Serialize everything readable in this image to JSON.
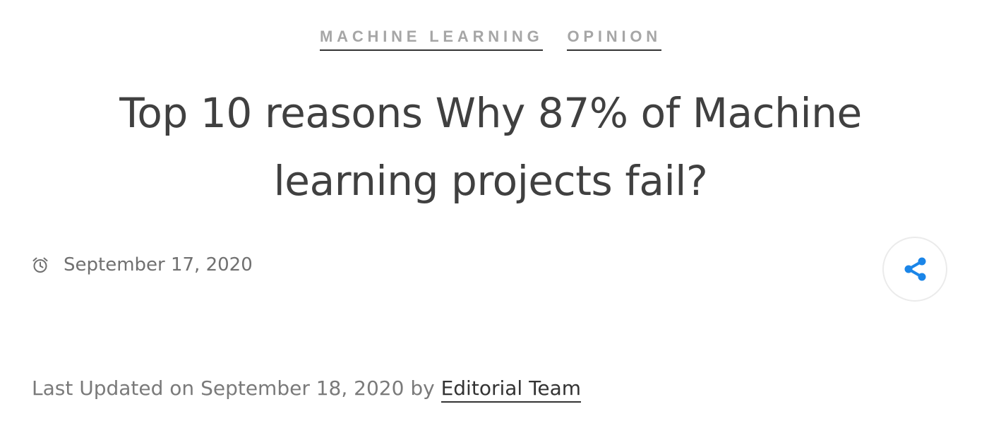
{
  "categories": [
    {
      "label": "MACHINE LEARNING"
    },
    {
      "label": "OPINION"
    }
  ],
  "article": {
    "title": "Top 10 reasons Why 87% of Machine learning projects fail?",
    "date": "September 17, 2020",
    "updated_prefix": "Last Updated on September 18, 2020 by",
    "author": "Editorial Team"
  },
  "icons": {
    "date": "alarm-clock-icon",
    "share": "share-icon"
  },
  "colors": {
    "accent": "#1a85e8",
    "title": "#404040",
    "category": "#a6a6a6",
    "meta": "#707070"
  }
}
